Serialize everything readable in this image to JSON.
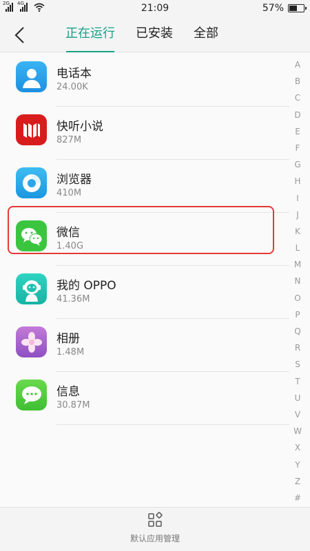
{
  "status": {
    "net1": "2G",
    "net2": "4G",
    "time": "21:09",
    "battery": "57%",
    "battery_level": 0.57
  },
  "header": {
    "tabs": [
      {
        "label": "正在运行",
        "active": true
      },
      {
        "label": "已安装",
        "active": false
      },
      {
        "label": "全部",
        "active": false
      }
    ]
  },
  "apps": [
    {
      "name": "电话本",
      "size": "24.00K",
      "icon": "contacts-icon"
    },
    {
      "name": "快听小说",
      "size": "827M",
      "icon": "novel-icon"
    },
    {
      "name": "浏览器",
      "size": "410M",
      "icon": "browser-icon"
    },
    {
      "name": "微信",
      "size": "1.40G",
      "icon": "wechat-icon"
    },
    {
      "name": "我的 OPPO",
      "size": "41.36M",
      "icon": "my-oppo-icon"
    },
    {
      "name": "相册",
      "size": "1.48M",
      "icon": "gallery-icon"
    },
    {
      "name": "信息",
      "size": "30.87M",
      "icon": "messages-icon"
    }
  ],
  "alphabet": [
    "A",
    "B",
    "C",
    "D",
    "E",
    "F",
    "G",
    "H",
    "I",
    "J",
    "K",
    "L",
    "M",
    "N",
    "O",
    "P",
    "Q",
    "R",
    "S",
    "T",
    "U",
    "V",
    "W",
    "X",
    "Y",
    "Z",
    "#"
  ],
  "bottom": {
    "label": "默认应用管理",
    "icon": "default-apps-icon"
  },
  "colors": {
    "accent": "#17a188",
    "highlight": "#e53935"
  }
}
